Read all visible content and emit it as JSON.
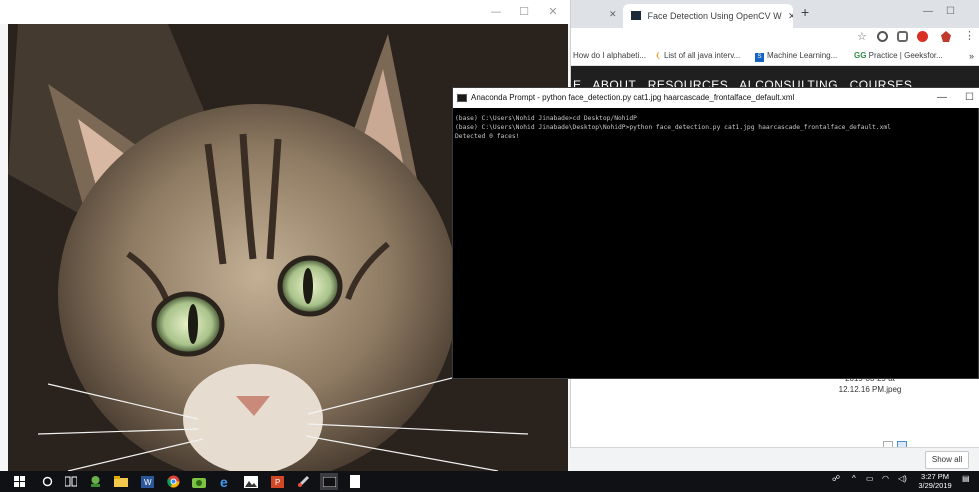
{
  "viewer": {
    "window_controls": [
      "—",
      "☐",
      "✕"
    ]
  },
  "chrome": {
    "tab_title": "Face Detection Using OpenCV W",
    "new_tab_label": "+",
    "bookmarks": [
      {
        "label": "How do I alphabeti..."
      },
      {
        "label": "List of all java interv..."
      },
      {
        "label": "Machine Learning..."
      },
      {
        "label": "Practice | Geeksfor..."
      }
    ],
    "site_nav": [
      "E",
      "ABOUT",
      "RESOURCES",
      "AI CONSULTING",
      "COURSES"
    ],
    "file_caption": "2019-03-29 at\n12.12.16 PM.jpeg",
    "show_all": "Show all"
  },
  "console": {
    "title": "Anaconda Prompt - python  face_detection.py cat1.jpg haarcascade_frontalface_default.xml",
    "lines": [
      "",
      "(base) C:\\Users\\Nohid Jinabade>cd Desktop/NohidP",
      "",
      "(base) C:\\Users\\Nohid Jinabade\\Desktop\\NohidP>python face_detection.py cat1.jpg haarcascade_frontalface_default.xml",
      "Detected 0 faces!"
    ]
  },
  "taskbar": {
    "clock_time": "3:27 PM",
    "clock_date": "3/29/2019",
    "icons": [
      "windows-start-icon",
      "search-icon",
      "task-view-icon",
      "app-icon",
      "file-explorer-icon",
      "word-icon",
      "chrome-icon",
      "camera-icon",
      "edge-icon",
      "photos-icon",
      "powerpoint-icon",
      "paint-icon",
      "console-icon",
      "notepad-icon"
    ]
  },
  "colors": {
    "console_bg": "#000000",
    "taskbar_bg": "#101114",
    "site_nav_bg": "#1f1f1f"
  }
}
